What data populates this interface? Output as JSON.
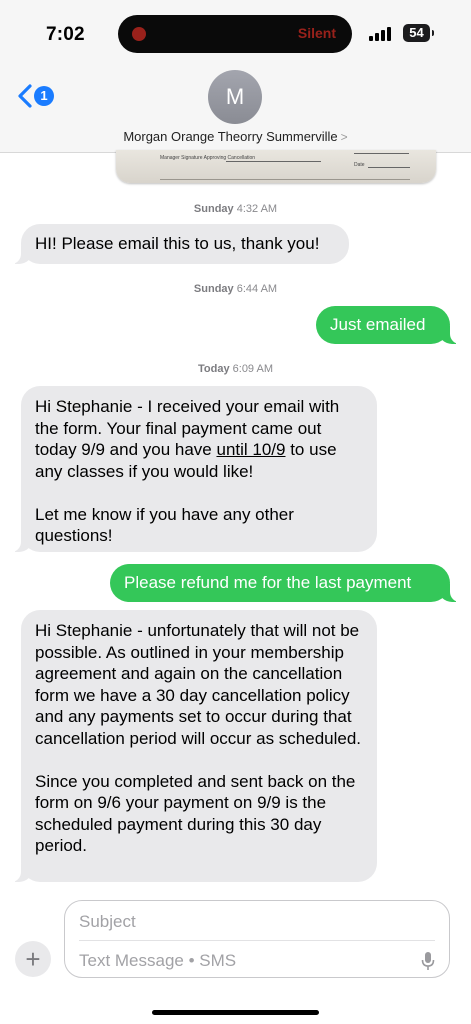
{
  "status_bar": {
    "time": "7:02",
    "island_text": "Silent",
    "battery": "54"
  },
  "header": {
    "back_badge": "1",
    "avatar_initial": "M",
    "contact_name": "Morgan Orange Theorry Summerville",
    "contact_chevron": ">"
  },
  "attachment": {
    "form_line_1": "Manager Signature Approving Cancellation",
    "form_line_2": "Date"
  },
  "messages": [
    {
      "type": "timestamp",
      "day": "Sunday",
      "time": "4:32 AM"
    },
    {
      "type": "received",
      "text": "HI! Please email this to us, thank you!"
    },
    {
      "type": "timestamp",
      "day": "Sunday",
      "time": "6:44 AM"
    },
    {
      "type": "sent",
      "text": "Just emailed"
    },
    {
      "type": "timestamp",
      "day": "Today",
      "time": "6:09 AM"
    },
    {
      "type": "received",
      "text_before_link": "Hi Stephanie - I received your email with the form. Your final payment came out today 9/9 and you have ",
      "link": "until 10/9",
      "text_after_link": " to use any classes if you would like!\n\nLet me know if you have any other questions!"
    },
    {
      "type": "sent",
      "text": "Please refund me for the last payment"
    },
    {
      "type": "received",
      "text": "Hi Stephanie - unfortunately that will not be possible. As outlined in your membership agreement and again on the cancellation form we have a 30 day cancellation policy and any payments set to occur during that cancellation period will occur as scheduled.\n\nSince you completed and sent back on the form on 9/6 your payment on 9/9 is the scheduled payment during this 30 day period."
    }
  ],
  "composer": {
    "subject_placeholder": "Subject",
    "message_placeholder": "Text Message • SMS",
    "plus_label": "+"
  },
  "icons": {
    "back": "chevron-left-icon",
    "add": "plus-icon",
    "mic": "microphone-icon",
    "signal": "cellular-signal-icon",
    "battery": "battery-icon"
  },
  "colors": {
    "sent_bubble": "#34c759",
    "received_bubble": "#e9e9eb",
    "accent": "#1a7cff"
  }
}
